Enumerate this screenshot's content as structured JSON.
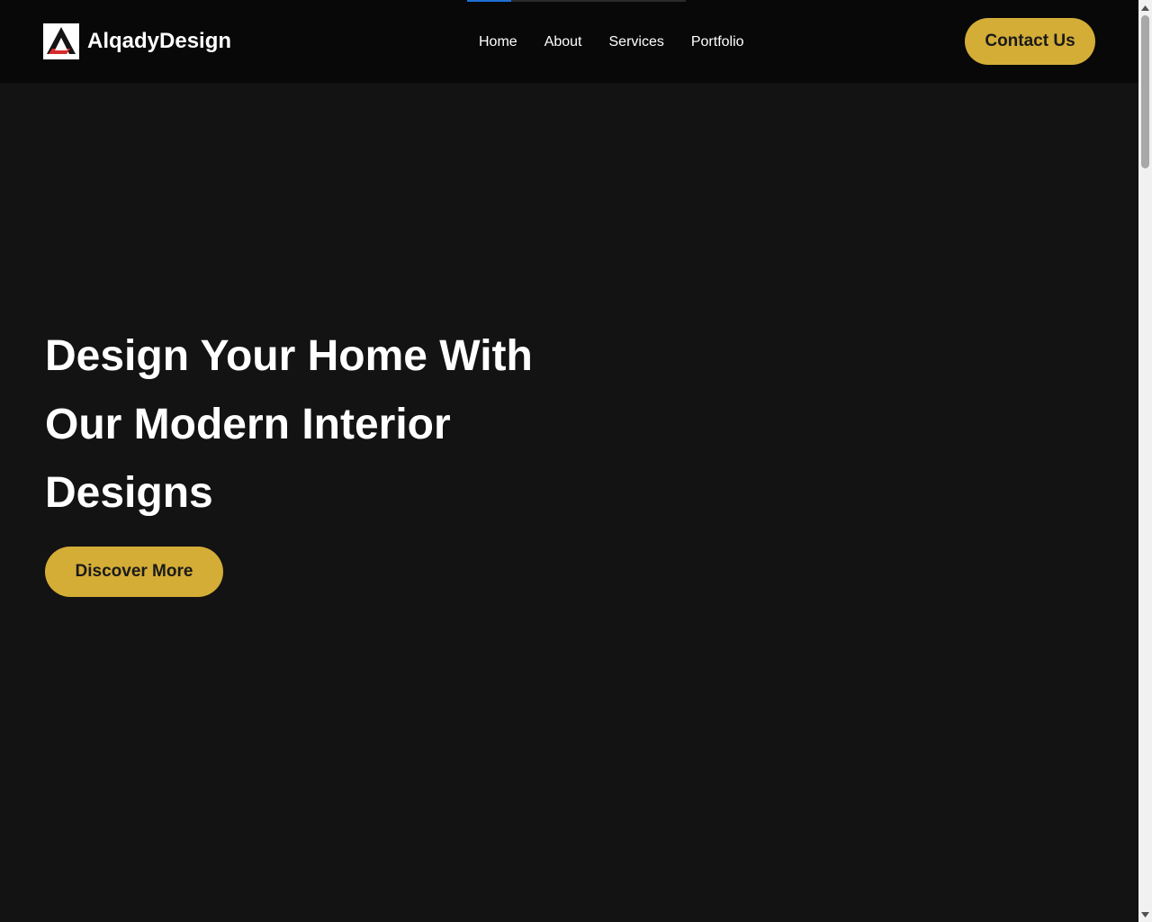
{
  "brand": {
    "name": "AlqadyDesign",
    "logo_icon": "alqady-triangle-logo"
  },
  "nav": {
    "items": [
      {
        "label": "Home"
      },
      {
        "label": "About"
      },
      {
        "label": "Services"
      },
      {
        "label": "Portfolio"
      }
    ],
    "active_index": 0
  },
  "header": {
    "contact_label": "Contact Us"
  },
  "hero": {
    "title_line1": "Design Your Home With",
    "title_line2": "Our Modern Interior",
    "title_line3": "Designs",
    "cta_label": "Discover More"
  },
  "colors": {
    "background": "#131313",
    "header_background": "#080808",
    "accent": "#d4ad36",
    "nav_indicator": "#1f6fd6",
    "logo_red": "#d62b2b"
  }
}
